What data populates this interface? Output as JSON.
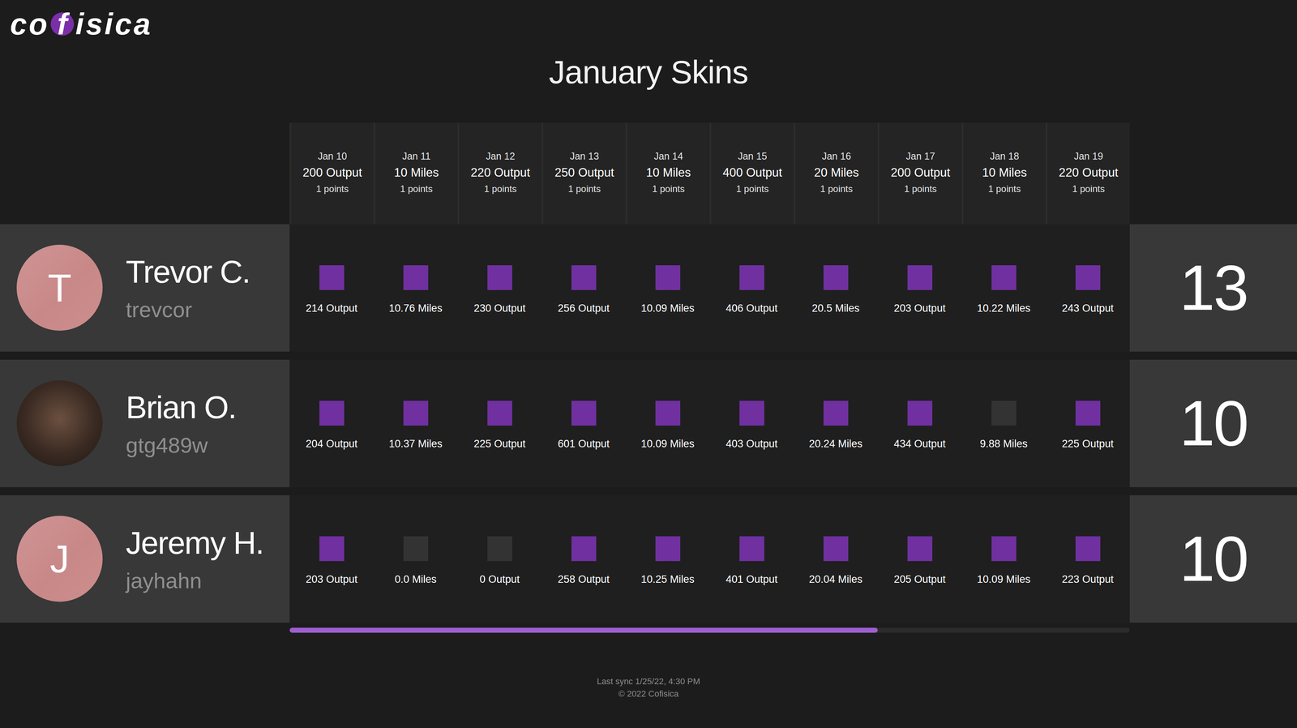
{
  "logo": {
    "before": "co",
    "mark": "f",
    "after": "isica"
  },
  "title": "January Skins",
  "days": [
    {
      "date": "Jan 10",
      "goal": "200 Output",
      "points": "1 points"
    },
    {
      "date": "Jan 11",
      "goal": "10 Miles",
      "points": "1 points"
    },
    {
      "date": "Jan 12",
      "goal": "220 Output",
      "points": "1 points"
    },
    {
      "date": "Jan 13",
      "goal": "250 Output",
      "points": "1 points"
    },
    {
      "date": "Jan 14",
      "goal": "10 Miles",
      "points": "1 points"
    },
    {
      "date": "Jan 15",
      "goal": "400 Output",
      "points": "1 points"
    },
    {
      "date": "Jan 16",
      "goal": "20 Miles",
      "points": "1 points"
    },
    {
      "date": "Jan 17",
      "goal": "200 Output",
      "points": "1 points"
    },
    {
      "date": "Jan 18",
      "goal": "10 Miles",
      "points": "1 points"
    },
    {
      "date": "Jan 19",
      "goal": "220 Output",
      "points": "1 points"
    }
  ],
  "players": [
    {
      "name": "Trevor C.",
      "username": "trevcor",
      "avatar": {
        "kind": "initial",
        "letter": "T"
      },
      "score": "13",
      "results": [
        {
          "value": "214 Output",
          "won": true
        },
        {
          "value": "10.76 Miles",
          "won": true
        },
        {
          "value": "230 Output",
          "won": true
        },
        {
          "value": "256 Output",
          "won": true
        },
        {
          "value": "10.09 Miles",
          "won": true
        },
        {
          "value": "406 Output",
          "won": true
        },
        {
          "value": "20.5 Miles",
          "won": true
        },
        {
          "value": "203 Output",
          "won": true
        },
        {
          "value": "10.22 Miles",
          "won": true
        },
        {
          "value": "243 Output",
          "won": true
        }
      ]
    },
    {
      "name": "Brian O.",
      "username": "gtg489w",
      "avatar": {
        "kind": "photo",
        "letter": ""
      },
      "score": "10",
      "results": [
        {
          "value": "204 Output",
          "won": true
        },
        {
          "value": "10.37 Miles",
          "won": true
        },
        {
          "value": "225 Output",
          "won": true
        },
        {
          "value": "601 Output",
          "won": true
        },
        {
          "value": "10.09 Miles",
          "won": true
        },
        {
          "value": "403 Output",
          "won": true
        },
        {
          "value": "20.24 Miles",
          "won": true
        },
        {
          "value": "434 Output",
          "won": true
        },
        {
          "value": "9.88 Miles",
          "won": false
        },
        {
          "value": "225 Output",
          "won": true
        }
      ]
    },
    {
      "name": "Jeremy H.",
      "username": "jayhahn",
      "avatar": {
        "kind": "initial",
        "letter": "J"
      },
      "score": "10",
      "results": [
        {
          "value": "203 Output",
          "won": true
        },
        {
          "value": "0.0 Miles",
          "won": false
        },
        {
          "value": "0 Output",
          "won": false
        },
        {
          "value": "258 Output",
          "won": true
        },
        {
          "value": "10.25 Miles",
          "won": true
        },
        {
          "value": "401 Output",
          "won": true
        },
        {
          "value": "20.04 Miles",
          "won": true
        },
        {
          "value": "205 Output",
          "won": true
        },
        {
          "value": "10.09 Miles",
          "won": true
        },
        {
          "value": "223 Output",
          "won": true
        }
      ]
    }
  ],
  "scrollbar": {
    "level": 0.7
  },
  "footer": {
    "sync": "Last sync 1/25/22, 4:30 PM",
    "copyright": "© 2022 Cofisica"
  }
}
